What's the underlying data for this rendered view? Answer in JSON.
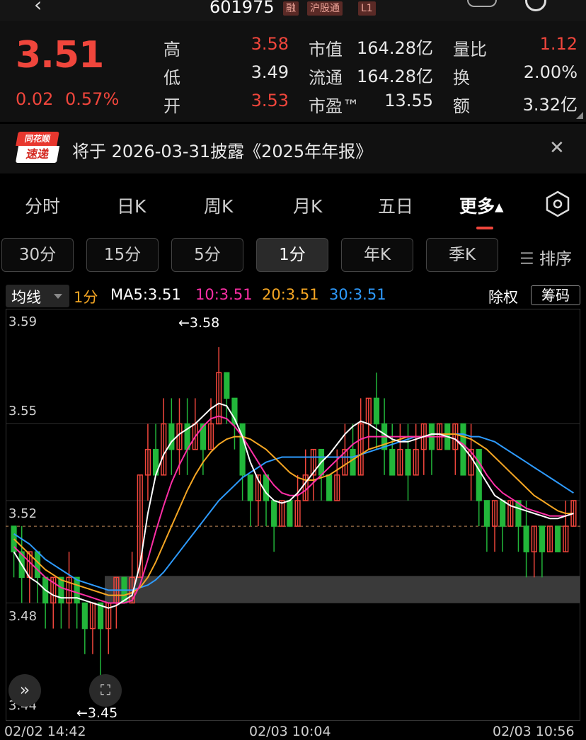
{
  "header": {
    "code": "601975",
    "tags": [
      "融",
      "沪股通",
      "L1"
    ]
  },
  "quote": {
    "price": "3.51",
    "change": "0.02",
    "change_pct": "0.57%",
    "high_label": "高",
    "high": "3.58",
    "low_label": "低",
    "low": "3.49",
    "open_label": "开",
    "open": "3.53",
    "mcap_label": "市值",
    "mcap": "164.28亿",
    "float_label": "流通",
    "float": "164.28亿",
    "pe_label": "市盈™",
    "pe": "13.55",
    "vol_ratio_label": "量比",
    "vol_ratio": "1.12",
    "turnover_label": "换",
    "turnover": "2.00%",
    "amount_label": "额",
    "amount": "3.32亿"
  },
  "news": {
    "logo_top": "同花顺",
    "logo_bottom": "速递",
    "text": "将于 2026-03-31披露《2025年年报》"
  },
  "tabs": [
    "分时",
    "日K",
    "周K",
    "月K",
    "五日",
    "更多▴"
  ],
  "periods": [
    "30分",
    "15分",
    "5分",
    "1分",
    "年K",
    "季K"
  ],
  "sort_label": "排序",
  "indicator": {
    "type": "均线",
    "period": "1分",
    "ma5": "MA5:3.51",
    "ma10": "10:3.51",
    "ma20": "20:3.51",
    "ma30": "30:3.51",
    "exright": "除权",
    "chips": "筹码"
  },
  "colors": {
    "up": "#f0463c",
    "down": "#22b63a",
    "ma5": "#ffffff",
    "ma10": "#ff2fa6",
    "ma20": "#f5a623",
    "ma30": "#2e9bff"
  },
  "chart_data": {
    "type": "candlestick",
    "y_ticks": [
      "3.59",
      "3.55",
      "3.52",
      "3.48",
      "3.44"
    ],
    "ylim": [
      3.44,
      3.59
    ],
    "max_label": "←3.58",
    "min_label": "←3.45",
    "dates": [
      "02/02 14:42",
      "02/03 10:04",
      "02/03 10:56"
    ],
    "current_price": 3.51,
    "candles": [
      [
        3.51,
        3.5,
        3.51,
        3.49
      ],
      [
        3.5,
        3.49,
        3.51,
        3.48
      ],
      [
        3.49,
        3.5,
        3.5,
        3.48
      ],
      [
        3.5,
        3.49,
        3.5,
        3.48
      ],
      [
        3.49,
        3.48,
        3.49,
        3.47
      ],
      [
        3.48,
        3.49,
        3.49,
        3.47
      ],
      [
        3.49,
        3.48,
        3.49,
        3.47
      ],
      [
        3.48,
        3.49,
        3.5,
        3.47
      ],
      [
        3.49,
        3.48,
        3.49,
        3.47
      ],
      [
        3.48,
        3.47,
        3.48,
        3.46
      ],
      [
        3.47,
        3.48,
        3.48,
        3.46
      ],
      [
        3.48,
        3.47,
        3.48,
        3.45
      ],
      [
        3.47,
        3.48,
        3.48,
        3.46
      ],
      [
        3.48,
        3.49,
        3.49,
        3.47
      ],
      [
        3.49,
        3.48,
        3.49,
        3.48
      ],
      [
        3.48,
        3.49,
        3.5,
        3.48
      ],
      [
        3.49,
        3.53,
        3.53,
        3.49
      ],
      [
        3.53,
        3.54,
        3.55,
        3.52
      ],
      [
        3.54,
        3.53,
        3.55,
        3.53
      ],
      [
        3.53,
        3.55,
        3.56,
        3.53
      ],
      [
        3.55,
        3.54,
        3.56,
        3.53
      ],
      [
        3.54,
        3.55,
        3.56,
        3.53
      ],
      [
        3.55,
        3.54,
        3.56,
        3.53
      ],
      [
        3.54,
        3.55,
        3.56,
        3.54
      ],
      [
        3.55,
        3.54,
        3.55,
        3.53
      ],
      [
        3.54,
        3.55,
        3.56,
        3.54
      ],
      [
        3.55,
        3.57,
        3.58,
        3.55
      ],
      [
        3.57,
        3.56,
        3.57,
        3.55
      ],
      [
        3.56,
        3.55,
        3.56,
        3.54
      ],
      [
        3.55,
        3.53,
        3.55,
        3.52
      ],
      [
        3.53,
        3.52,
        3.53,
        3.51
      ],
      [
        3.52,
        3.53,
        3.53,
        3.51
      ],
      [
        3.53,
        3.52,
        3.53,
        3.51
      ],
      [
        3.52,
        3.51,
        3.52,
        3.5
      ],
      [
        3.51,
        3.52,
        3.52,
        3.51
      ],
      [
        3.52,
        3.51,
        3.52,
        3.51
      ],
      [
        3.51,
        3.52,
        3.53,
        3.51
      ],
      [
        3.52,
        3.53,
        3.54,
        3.52
      ],
      [
        3.53,
        3.54,
        3.54,
        3.52
      ],
      [
        3.54,
        3.53,
        3.54,
        3.52
      ],
      [
        3.53,
        3.52,
        3.53,
        3.52
      ],
      [
        3.52,
        3.53,
        3.54,
        3.52
      ],
      [
        3.53,
        3.54,
        3.55,
        3.53
      ],
      [
        3.54,
        3.53,
        3.55,
        3.53
      ],
      [
        3.53,
        3.55,
        3.56,
        3.53
      ],
      [
        3.55,
        3.56,
        3.56,
        3.54
      ],
      [
        3.56,
        3.55,
        3.57,
        3.54
      ],
      [
        3.55,
        3.54,
        3.56,
        3.53
      ],
      [
        3.54,
        3.53,
        3.55,
        3.53
      ],
      [
        3.53,
        3.54,
        3.55,
        3.53
      ],
      [
        3.54,
        3.53,
        3.55,
        3.52
      ],
      [
        3.53,
        3.54,
        3.55,
        3.53
      ],
      [
        3.54,
        3.55,
        3.55,
        3.53
      ],
      [
        3.55,
        3.54,
        3.55,
        3.53
      ],
      [
        3.54,
        3.55,
        3.55,
        3.54
      ],
      [
        3.55,
        3.54,
        3.55,
        3.54
      ],
      [
        3.54,
        3.55,
        3.55,
        3.53
      ],
      [
        3.55,
        3.53,
        3.55,
        3.53
      ],
      [
        3.53,
        3.54,
        3.55,
        3.52
      ],
      [
        3.54,
        3.52,
        3.54,
        3.51
      ],
      [
        3.52,
        3.51,
        3.52,
        3.5
      ],
      [
        3.51,
        3.52,
        3.52,
        3.5
      ],
      [
        3.52,
        3.51,
        3.52,
        3.5
      ],
      [
        3.51,
        3.52,
        3.52,
        3.51
      ],
      [
        3.52,
        3.51,
        3.52,
        3.5
      ],
      [
        3.51,
        3.5,
        3.52,
        3.49
      ],
      [
        3.5,
        3.51,
        3.51,
        3.49
      ],
      [
        3.51,
        3.5,
        3.51,
        3.49
      ],
      [
        3.5,
        3.51,
        3.51,
        3.5
      ],
      [
        3.51,
        3.5,
        3.51,
        3.5
      ],
      [
        3.5,
        3.51,
        3.52,
        3.5
      ],
      [
        3.51,
        3.52,
        3.52,
        3.51
      ]
    ],
    "ma5": [
      3.5,
      3.495,
      3.49,
      3.488,
      3.485,
      3.483,
      3.482,
      3.482,
      3.482,
      3.481,
      3.48,
      3.479,
      3.478,
      3.479,
      3.481,
      3.483,
      3.495,
      3.515,
      3.53,
      3.538,
      3.543,
      3.546,
      3.548,
      3.55,
      3.553,
      3.556,
      3.558,
      3.557,
      3.552,
      3.545,
      3.535,
      3.528,
      3.523,
      3.52,
      3.519,
      3.52,
      3.523,
      3.527,
      3.531,
      3.535,
      3.538,
      3.542,
      3.546,
      3.549,
      3.551,
      3.55,
      3.548,
      3.546,
      3.544,
      3.543,
      3.543,
      3.544,
      3.545,
      3.546,
      3.546,
      3.545,
      3.544,
      3.541,
      3.537,
      3.532,
      3.527,
      3.522,
      3.52,
      3.518,
      3.517,
      3.516,
      3.515,
      3.514,
      3.513,
      3.513,
      3.514,
      3.515
    ],
    "ma10": [
      3.502,
      3.499,
      3.496,
      3.493,
      3.49,
      3.488,
      3.486,
      3.485,
      3.484,
      3.483,
      3.482,
      3.481,
      3.48,
      3.48,
      3.48,
      3.481,
      3.487,
      3.497,
      3.508,
      3.518,
      3.527,
      3.534,
      3.54,
      3.545,
      3.549,
      3.552,
      3.553,
      3.552,
      3.549,
      3.545,
      3.54,
      3.535,
      3.53,
      3.526,
      3.523,
      3.522,
      3.522,
      3.524,
      3.527,
      3.53,
      3.533,
      3.536,
      3.539,
      3.542,
      3.544,
      3.545,
      3.545,
      3.545,
      3.545,
      3.545,
      3.545,
      3.545,
      3.545,
      3.545,
      3.545,
      3.545,
      3.544,
      3.542,
      3.539,
      3.535,
      3.53,
      3.526,
      3.523,
      3.521,
      3.519,
      3.517,
      3.516,
      3.515,
      3.514,
      3.514,
      3.514,
      3.515
    ],
    "ma20": [
      3.505,
      3.502,
      3.499,
      3.496,
      3.493,
      3.491,
      3.489,
      3.488,
      3.487,
      3.486,
      3.485,
      3.484,
      3.483,
      3.483,
      3.483,
      3.484,
      3.486,
      3.49,
      3.496,
      3.503,
      3.51,
      3.517,
      3.524,
      3.53,
      3.535,
      3.539,
      3.542,
      3.544,
      3.545,
      3.545,
      3.544,
      3.542,
      3.54,
      3.537,
      3.534,
      3.531,
      3.529,
      3.528,
      3.528,
      3.529,
      3.53,
      3.532,
      3.534,
      3.536,
      3.538,
      3.54,
      3.541,
      3.542,
      3.543,
      3.544,
      3.545,
      3.545,
      3.545,
      3.546,
      3.546,
      3.546,
      3.546,
      3.545,
      3.544,
      3.542,
      3.54,
      3.537,
      3.534,
      3.531,
      3.528,
      3.525,
      3.522,
      3.52,
      3.518,
      3.516,
      3.515,
      3.515
    ],
    "ma30": [
      3.507,
      3.505,
      3.503,
      3.5,
      3.497,
      3.495,
      3.493,
      3.491,
      3.489,
      3.488,
      3.487,
      3.486,
      3.485,
      3.485,
      3.485,
      3.485,
      3.486,
      3.487,
      3.489,
      3.492,
      3.496,
      3.5,
      3.504,
      3.508,
      3.512,
      3.516,
      3.52,
      3.523,
      3.526,
      3.529,
      3.531,
      3.533,
      3.535,
      3.536,
      3.537,
      3.537,
      3.537,
      3.537,
      3.537,
      3.537,
      3.537,
      3.537,
      3.537,
      3.537,
      3.538,
      3.539,
      3.54,
      3.541,
      3.542,
      3.543,
      3.544,
      3.545,
      3.545,
      3.546,
      3.546,
      3.546,
      3.546,
      3.546,
      3.545,
      3.545,
      3.544,
      3.543,
      3.541,
      3.539,
      3.537,
      3.535,
      3.533,
      3.531,
      3.529,
      3.527,
      3.525,
      3.523
    ]
  }
}
